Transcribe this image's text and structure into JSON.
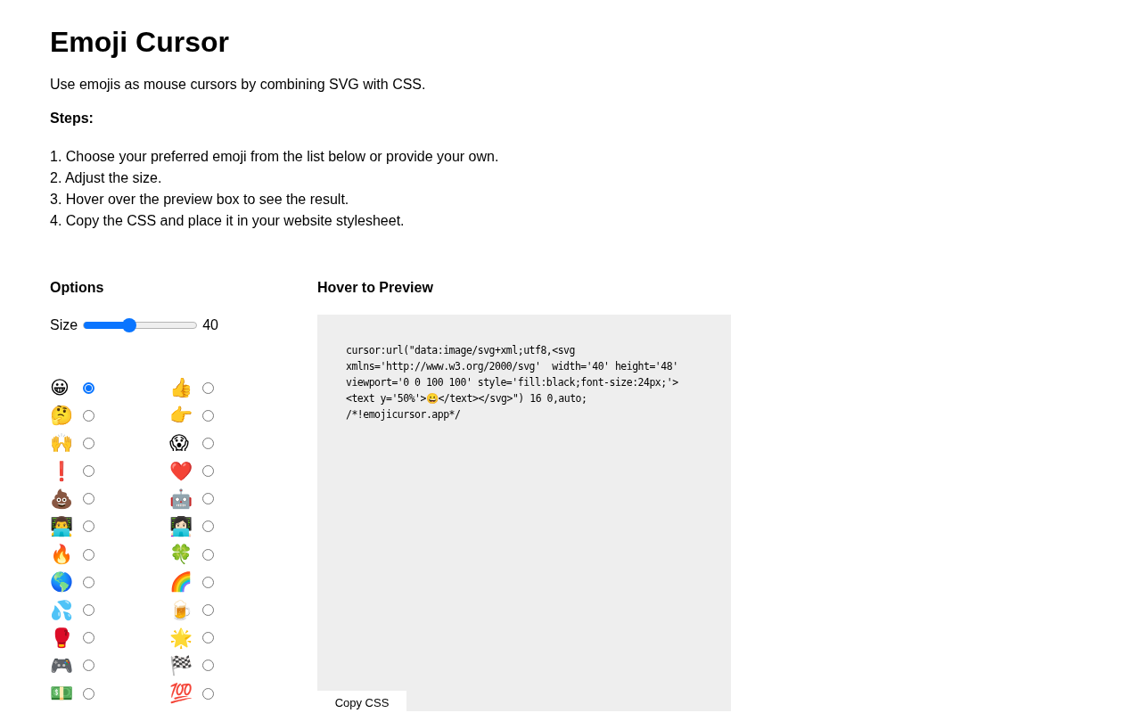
{
  "title": "Emoji Cursor",
  "intro": "Use emojis as mouse cursors by combining SVG with CSS.",
  "steps_heading": "Steps:",
  "steps": [
    "1. Choose your preferred emoji from the list below or provide your own.",
    "2. Adjust the size.",
    "3. Hover over the preview box to see the result.",
    "4. Copy the CSS and place it in your website stylesheet."
  ],
  "options": {
    "heading": "Options",
    "size_label": "Size",
    "size": {
      "level": 0.4,
      "reading": "40"
    },
    "emojis": [
      {
        "emoji": "😀",
        "selected": true
      },
      {
        "emoji": "👍",
        "selected": false
      },
      {
        "emoji": "🤔",
        "selected": false
      },
      {
        "emoji": "👉",
        "selected": false
      },
      {
        "emoji": "🙌",
        "selected": false
      },
      {
        "emoji": "😱",
        "selected": false
      },
      {
        "emoji": "❗",
        "selected": false
      },
      {
        "emoji": "❤️",
        "selected": false
      },
      {
        "emoji": "💩",
        "selected": false
      },
      {
        "emoji": "🤖",
        "selected": false
      },
      {
        "emoji": "👨‍💻",
        "selected": false
      },
      {
        "emoji": "👩🏻‍💻",
        "selected": false
      },
      {
        "emoji": "🔥",
        "selected": false
      },
      {
        "emoji": "🍀",
        "selected": false
      },
      {
        "emoji": "🌎",
        "selected": false
      },
      {
        "emoji": "🌈",
        "selected": false
      },
      {
        "emoji": "💦",
        "selected": false
      },
      {
        "emoji": "🍺",
        "selected": false
      },
      {
        "emoji": "🥊",
        "selected": false
      },
      {
        "emoji": "🌟",
        "selected": false
      },
      {
        "emoji": "🎮",
        "selected": false
      },
      {
        "emoji": "🏁",
        "selected": false
      },
      {
        "emoji": "💵",
        "selected": false
      },
      {
        "emoji": "💯",
        "selected": false
      }
    ]
  },
  "preview": {
    "heading": "Hover to Preview",
    "code": "cursor:url(\"data:image/svg+xml;utf8,<svg\nxmlns='http://www.w3.org/2000/svg'  width='40' height='48'\nviewport='0 0 100 100' style='fill:black;font-size:24px;'>\n<text y='50%'>😀</text></svg>\") 16 0,auto;\n/*!emojicursor.app*/",
    "button": "Copy CSS"
  }
}
